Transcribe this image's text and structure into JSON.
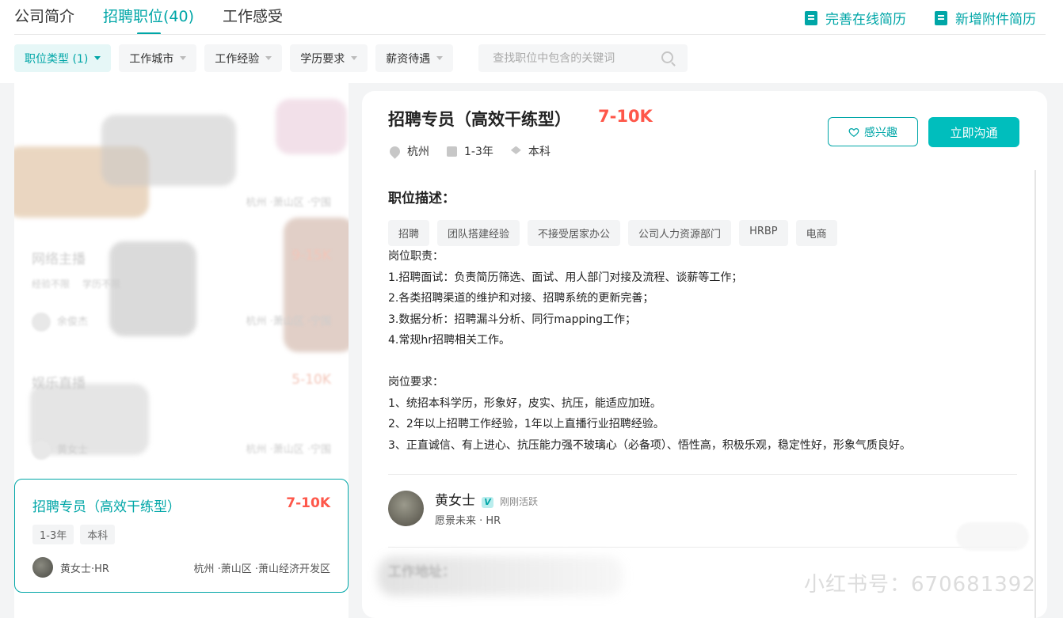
{
  "tabs": [
    "公司简介",
    "招聘职位(40)",
    "工作感受"
  ],
  "actions": {
    "complete_resume": "完善在线简历",
    "add_attachment": "新增附件简历"
  },
  "filters": [
    "职位类型 (1)",
    "工作城市",
    "工作经验",
    "学历要求",
    "薪资待遇"
  ],
  "search": {
    "placeholder": "查找职位中包含的关键词"
  },
  "job_list": {
    "ghost_items": [
      {
        "title": "网络主播",
        "salary": "9-15K",
        "tags": [
          "经验不限",
          "学历不限"
        ],
        "hr": "余俊杰",
        "location": "杭州 ·萧山区 ·宁围"
      },
      {
        "title": "娱乐直播",
        "salary": "5-10K",
        "tags": [],
        "hr": "黄女士",
        "location": "杭州 ·萧山区 ·宁围"
      }
    ],
    "ghost_location_top": "杭州 ·萧山区 ·宁围",
    "selected": {
      "title": "招聘专员（高效干练型）",
      "salary": "7-10K",
      "tags": [
        "1-3年",
        "本科"
      ],
      "hr": "黄女士·HR",
      "location": "杭州 ·萧山区 ·萧山经济开发区"
    }
  },
  "detail": {
    "title": "招聘专员（高效干练型）",
    "salary": "7-10K",
    "city": "杭州",
    "experience": "1-3年",
    "degree": "本科",
    "btn_interest": "感兴趣",
    "btn_chat": "立即沟通",
    "section_title": "职位描述：",
    "skills": [
      "招聘",
      "团队搭建经验",
      "不接受居家办公",
      "公司人力资源部门",
      "HRBP",
      "电商"
    ],
    "description": "岗位职责：\n1.招聘面试：负责简历筛选、面试、用人部门对接及流程、谈薪等工作；\n2.各类招聘渠道的维护和对接、招聘系统的更新完善；\n3.数据分析：招聘漏斗分析、同行mapping工作；\n4.常规hr招聘相关工作。\n\n岗位要求：\n1、统招本科学历，形象好，皮实、抗压，能适应加班。\n2、2年以上招聘工作经验，1年以上直播行业招聘经验。\n3、正直诚信、有上进心、抗压能力强不玻璃心（必备项）、悟性高，积极乐观，稳定性好，形象气质良好。",
    "boss": {
      "name": "黄女士",
      "badge": "V",
      "active": "刚刚活跃",
      "sub": "愿景未来 · HR"
    },
    "address_title": "工作地址："
  },
  "watermark": "小红书号：670681392",
  "colors": {
    "accent": "#00a6a7",
    "salary": "#fe574a",
    "button": "#00bebd"
  }
}
